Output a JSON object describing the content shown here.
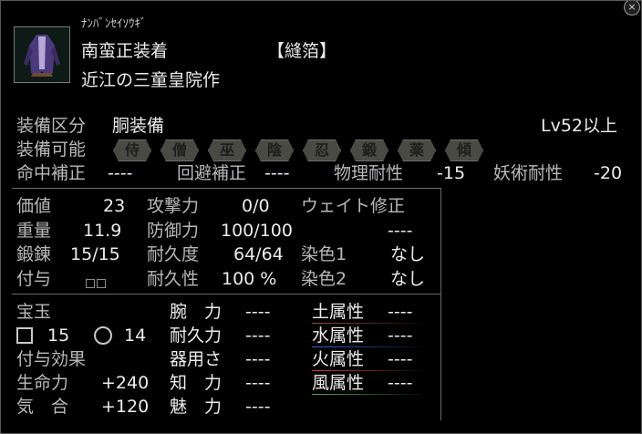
{
  "window": {
    "close_glyph": "×"
  },
  "item": {
    "icon": "robe-armor-icon",
    "reading": "ﾅﾝﾊﾞﾝｾｲｿｳｷﾞ",
    "name": "南蛮正装着",
    "category": "【縫箔】",
    "maker": "近江の三童皇院作"
  },
  "equip": {
    "class_label": "装備区分",
    "class_value": "胴装備",
    "level_req": "Lv52以上",
    "can_label": "装備可能",
    "classes": [
      "侍",
      "僧",
      "巫",
      "陰",
      "忍",
      "鍛",
      "薬",
      "傾"
    ]
  },
  "correction": {
    "hit_label": "命中補正",
    "hit_value": "----",
    "evade_label": "回避補正",
    "evade_value": "----",
    "phys_label": "物理耐性",
    "phys_value": "-15",
    "magic_label": "妖術耐性",
    "magic_value": "-20"
  },
  "stats": {
    "value_label": "価値",
    "value": "23",
    "attack_label": "攻撃力",
    "attack": "0/0",
    "weight_label": "ウェイト修正",
    "weight_mod": "----",
    "heavy_label": "重量",
    "heavy": "11.9",
    "defense_label": "防御力",
    "defense": "100/100",
    "forge_label": "鍛錬",
    "forge": "15/15",
    "durability_label": "耐久度",
    "durability": "64/64",
    "dye1_label": "染色1",
    "dye1": "なし",
    "grant_label": "付与",
    "dur_pct_label": "耐久性",
    "dur_pct": "100 %",
    "dye2_label": "染色2",
    "dye2": "なし"
  },
  "gems": {
    "label": "宝玉",
    "square_count": "15",
    "circle_count": "14",
    "effect_label": "付与効果",
    "life_label": "生命力",
    "life": "+240",
    "ki_label": "気　合",
    "ki": "+120"
  },
  "attrs": [
    {
      "label": "腕　力",
      "value": "----"
    },
    {
      "label": "耐久力",
      "value": "----"
    },
    {
      "label": "器用さ",
      "value": "----"
    },
    {
      "label": "知　力",
      "value": "----"
    },
    {
      "label": "魅　力",
      "value": "----"
    }
  ],
  "elements": [
    {
      "label": "土属性",
      "value": "----",
      "color": "#a0522d"
    },
    {
      "label": "水属性",
      "value": "----",
      "color": "#2f6fd6"
    },
    {
      "label": "火属性",
      "value": "----",
      "color": "#d23a2a"
    },
    {
      "label": "風属性",
      "value": "----",
      "color": "#4aa86a"
    }
  ]
}
